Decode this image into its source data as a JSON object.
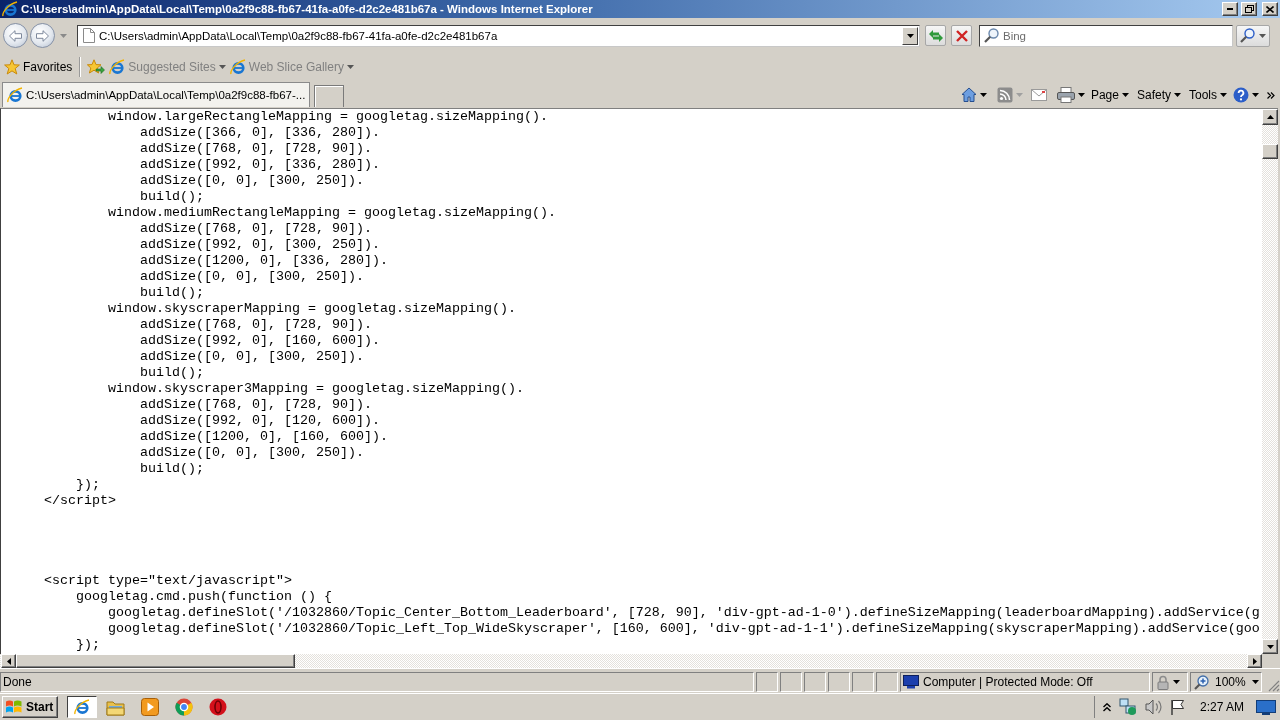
{
  "window": {
    "title": "C:\\Users\\admin\\AppData\\Local\\Temp\\0a2f9c88-fb67-41fa-a0fe-d2c2e481b67a - Windows Internet Explorer"
  },
  "address_bar": {
    "value": "C:\\Users\\admin\\AppData\\Local\\Temp\\0a2f9c88-fb67-41fa-a0fe-d2c2e481b67a"
  },
  "search": {
    "placeholder": "Bing"
  },
  "favorites_bar": {
    "favorites": "Favorites",
    "items": [
      {
        "label": "Suggested Sites",
        "disabled": true
      },
      {
        "label": "Web Slice Gallery",
        "disabled": true
      }
    ]
  },
  "tabs": [
    {
      "label": "C:\\Users\\admin\\AppData\\Local\\Temp\\0a2f9c88-fb67-...",
      "selected": true
    }
  ],
  "command_bar": {
    "menus": [
      "Page",
      "Safety",
      "Tools"
    ]
  },
  "source": {
    "blocks": [
      {
        "lines": [
          "            window.largeRectangleMapping = googletag.sizeMapping().",
          "                addSize([366, 0], [336, 280]).",
          "                addSize([768, 0], [728, 90]).",
          "                addSize([992, 0], [336, 280]).",
          "                addSize([0, 0], [300, 250]).",
          "                build();",
          "            window.mediumRectangleMapping = googletag.sizeMapping().",
          "                addSize([768, 0], [728, 90]).",
          "                addSize([992, 0], [300, 250]).",
          "                addSize([1200, 0], [336, 280]).",
          "                addSize([0, 0], [300, 250]).",
          "                build();",
          "            window.skyscraperMapping = googletag.sizeMapping().",
          "                addSize([768, 0], [728, 90]).",
          "                addSize([992, 0], [160, 600]).",
          "                addSize([0, 0], [300, 250]).",
          "                build();",
          "            window.skyscraper3Mapping = googletag.sizeMapping().",
          "                addSize([768, 0], [728, 90]).",
          "                addSize([992, 0], [120, 600]).",
          "                addSize([1200, 0], [160, 600]).",
          "                addSize([0, 0], [300, 250]).",
          "                build();",
          "        });",
          "    </script>"
        ]
      },
      {
        "lines": [
          "    <script type=\"text/javascript\">",
          "        googletag.cmd.push(function () {",
          "            googletag.defineSlot('/1032860/Topic_Center_Bottom_Leaderboard', [728, 90], 'div-gpt-ad-1-0').defineSizeMapping(leaderboardMapping).addService(g",
          "            googletag.defineSlot('/1032860/Topic_Left_Top_WideSkyscraper', [160, 600], 'div-gpt-ad-1-1').defineSizeMapping(skyscraperMapping).addService(goo",
          "        });"
        ]
      }
    ]
  },
  "status_bar": {
    "status": "Done",
    "zone": "Computer | Protected Mode: Off",
    "zoom": "100%"
  },
  "taskbar": {
    "start": "Start",
    "apps": [
      {
        "kind": "elogo",
        "selected": true
      },
      {
        "kind": "folder",
        "selected": false
      },
      {
        "kind": "player",
        "selected": false
      },
      {
        "kind": "ring",
        "selected": false
      },
      {
        "kind": "obadge",
        "selected": false
      }
    ],
    "clock": "2:27 AM"
  }
}
